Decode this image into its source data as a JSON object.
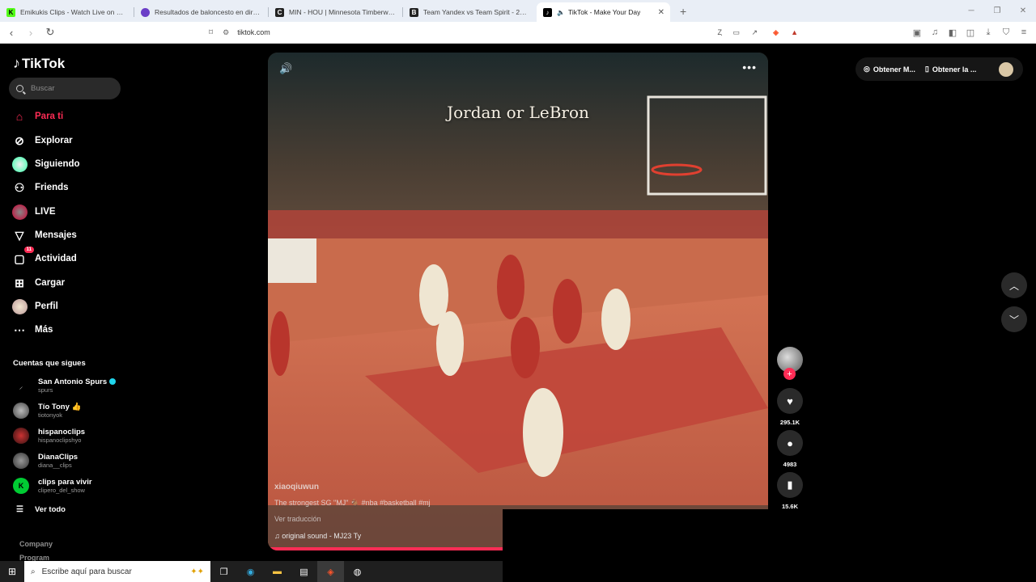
{
  "browser": {
    "tabs": [
      {
        "title": "Emikukis Clips - Watch Live on Kick",
        "icon_letter": "K",
        "icon_color": "#53fc18"
      },
      {
        "title": "Resultados de baloncesto en directo",
        "icon_letter": "",
        "icon_color": "#6b3ec7"
      },
      {
        "title": "MIN - HOU | Minnesota Timberwolves",
        "icon_letter": "C",
        "icon_color": "#222222"
      },
      {
        "title": "Team Yandex vs Team Spirit - 26/03/2",
        "icon_letter": "B",
        "icon_color": "#222222"
      },
      {
        "title": "TikTok - Make Your Day",
        "icon_letter": "",
        "icon_color": "#000000",
        "active": true
      }
    ],
    "url": "tiktok.com"
  },
  "tiktok": {
    "brand": "TikTok",
    "search_placeholder": "Buscar",
    "nav": [
      {
        "label": "Para ti",
        "icon": "home-icon",
        "active": true
      },
      {
        "label": "Explorar",
        "icon": "compass-icon"
      },
      {
        "label": "Siguiendo",
        "icon": "following-avatar"
      },
      {
        "label": "Friends",
        "icon": "friends-icon"
      },
      {
        "label": "LIVE",
        "icon": "live-icon"
      },
      {
        "label": "Mensajes",
        "icon": "messages-icon"
      },
      {
        "label": "Actividad",
        "icon": "activity-icon",
        "badge": "11"
      },
      {
        "label": "Cargar",
        "icon": "upload-icon"
      },
      {
        "label": "Perfil",
        "icon": "profile-avatar"
      },
      {
        "label": "Más",
        "icon": "more-icon"
      }
    ],
    "following_header": "Cuentas que sigues",
    "accounts": [
      {
        "name": "San Antonio Spurs",
        "handle": "spurs",
        "verified": true
      },
      {
        "name": "Tío Tony 👍",
        "handle": "tiotonyok"
      },
      {
        "name": "hispanoclips",
        "handle": "hispanoclipshyo"
      },
      {
        "name": "DianaClips",
        "handle": "diana__clips"
      },
      {
        "name": "clips para vivir",
        "handle": "clipero_del_show"
      }
    ],
    "see_all": "Ver todo",
    "footer": [
      "Company",
      "Program"
    ],
    "top_right": {
      "get_coins": "Obtener M...",
      "get_app": "Obtener la ..."
    },
    "video": {
      "title_overlay": "Jordan or LeBron",
      "author": "xiaoqiuwun",
      "description": "The strongest SG \"MJ\" 🐐 #nba #basketball #mj",
      "translate": "Ver traducción",
      "sound": "original sound - MJ23 Ty",
      "progress": 0.47
    },
    "actions": {
      "likes": "295.1K",
      "comments": "4983",
      "saves": "15.6K"
    }
  },
  "taskbar": {
    "search_placeholder": "Escribe aquí para buscar"
  }
}
